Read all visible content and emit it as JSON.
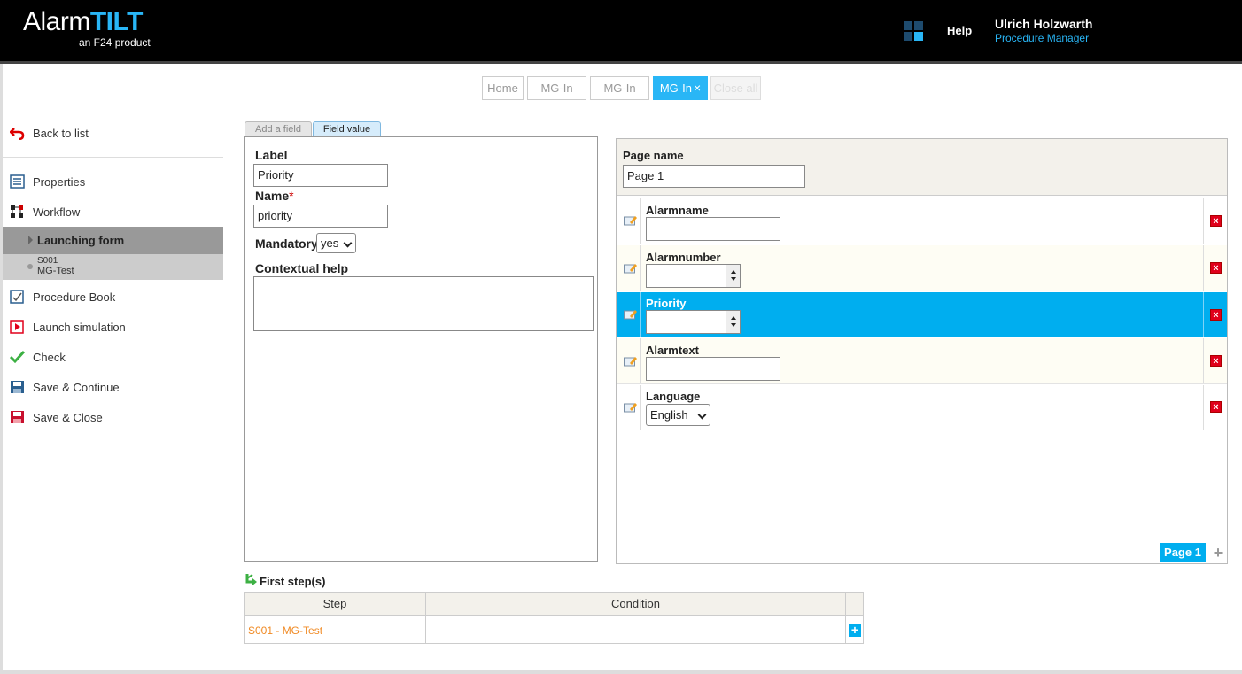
{
  "header": {
    "logo_main": "Alarm",
    "logo_accent": "TILT",
    "logo_sub": "an F24 product",
    "help": "Help",
    "user_name": "Ulrich Holzwarth",
    "user_role": "Procedure Manager"
  },
  "tabs": [
    {
      "label": "Home"
    },
    {
      "label": "MG-In"
    },
    {
      "label": "MG-In"
    },
    {
      "label": "MG-In",
      "close": "×"
    },
    {
      "label": "Close all"
    }
  ],
  "sidebar": {
    "back": "Back to list",
    "properties": "Properties",
    "workflow": "Workflow",
    "launching_form": "Launching form",
    "sub_code": "S001",
    "sub_name": "MG-Test",
    "procedure_book": "Procedure Book",
    "launch_simulation": "Launch simulation",
    "check": "Check",
    "save_continue": "Save & Continue",
    "save_close": "Save & Close"
  },
  "panel_tabs": {
    "add_field": "Add a field",
    "field_value": "Field value"
  },
  "field_form": {
    "label_label": "Label",
    "label_value": "Priority",
    "name_label": "Name",
    "name_required": "*",
    "name_value": "priority",
    "mandatory_label": "Mandatory",
    "mandatory_value": "yes",
    "help_label": "Contextual help",
    "help_value": ""
  },
  "page_editor": {
    "page_name_label": "Page name",
    "page_name_value": "Page 1",
    "fields": [
      {
        "label": "Alarmname",
        "type": "text",
        "value": ""
      },
      {
        "label": "Alarmnumber",
        "type": "number",
        "value": ""
      },
      {
        "label": "Priority",
        "type": "number",
        "value": "",
        "selected": true
      },
      {
        "label": "Alarmtext",
        "type": "text",
        "value": ""
      },
      {
        "label": "Language",
        "type": "select",
        "value": "English"
      }
    ],
    "delete_glyph": "×",
    "page_tab": "Page 1",
    "add_page": "+"
  },
  "first_steps": {
    "title": "First step(s)",
    "col_step": "Step",
    "col_condition": "Condition",
    "rows": [
      {
        "step": "S001 - MG-Test",
        "condition": ""
      }
    ],
    "add": "+"
  },
  "colors": {
    "accent": "#00aeef",
    "link_orange": "#f08a24",
    "delete_red": "#e0001b"
  }
}
